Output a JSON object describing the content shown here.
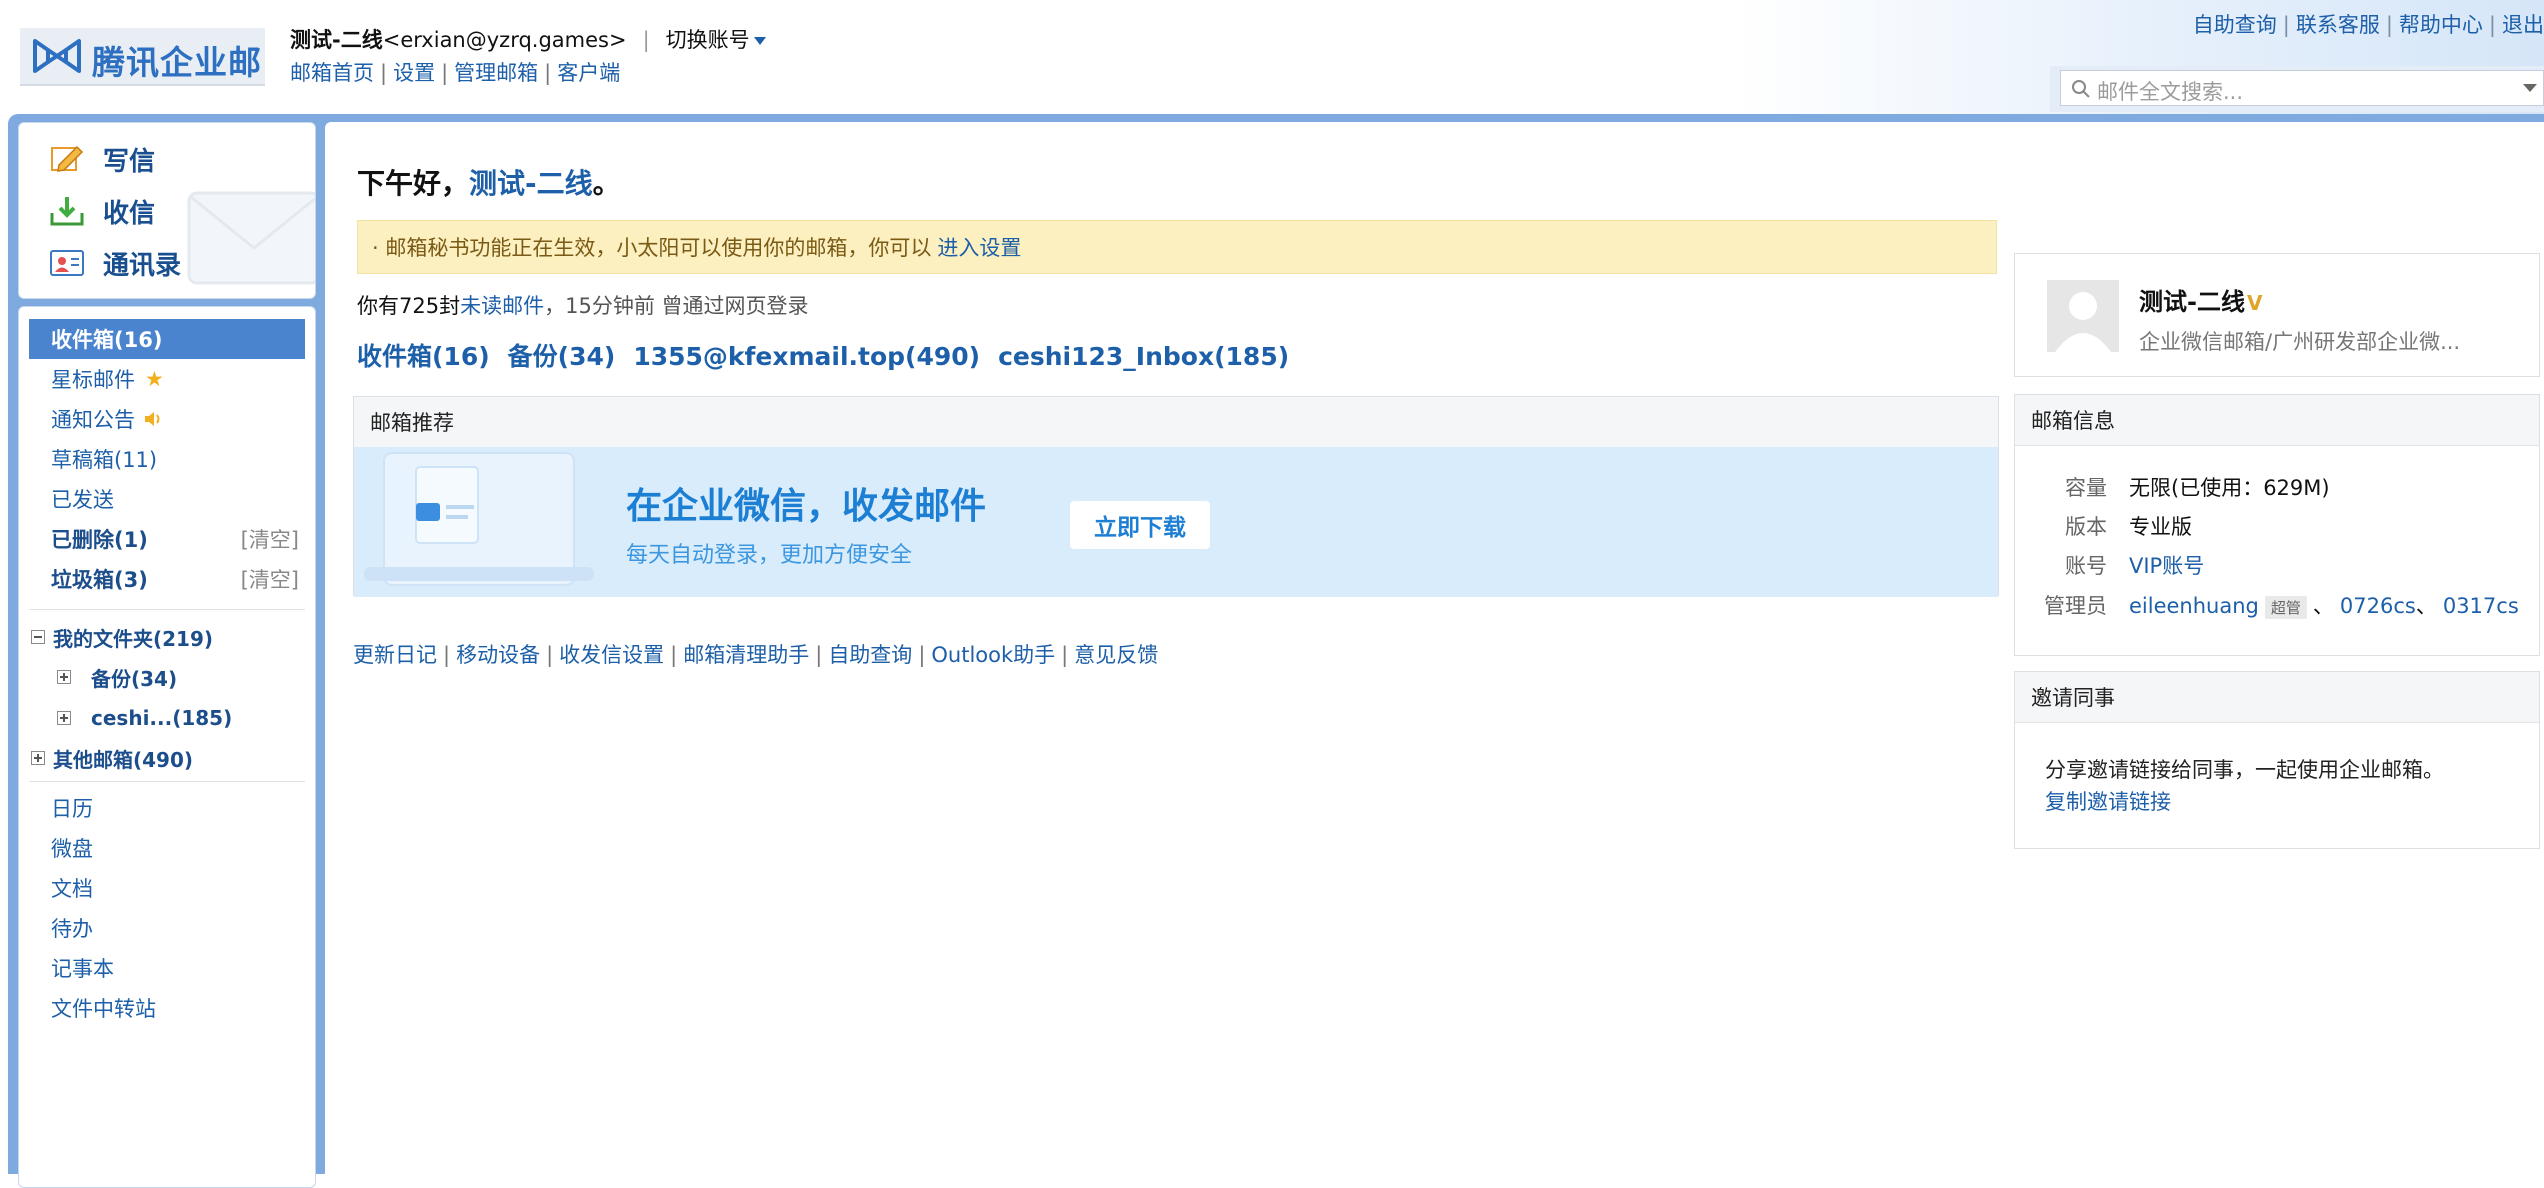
{
  "brand": {
    "logo_text": "腾讯企业邮"
  },
  "account": {
    "display_name": "测试-二线",
    "email": "<erxian@yzrq.games>",
    "switch_label": "切换账号"
  },
  "nav": {
    "links": [
      "邮箱首页",
      "设置",
      "管理邮箱",
      "客户端"
    ]
  },
  "top_right": {
    "links": [
      "自助查询",
      "联系客服",
      "帮助中心",
      "退出"
    ]
  },
  "search": {
    "placeholder": "邮件全文搜索..."
  },
  "actions": {
    "compose": "写信",
    "receive": "收信",
    "contacts": "通讯录"
  },
  "folders": {
    "inbox": "收件箱(16)",
    "starred": "星标邮件",
    "notice": "通知公告",
    "drafts": "草稿箱(11)",
    "sent": "已发送",
    "deleted": "已删除(1)",
    "spam": "垃圾箱(3)",
    "clear_label": "[清空]"
  },
  "my_folders": {
    "title": "我的文件夹(219)",
    "items": [
      "备份(34)",
      "ceshi...(185)"
    ]
  },
  "other_mailboxes": "其他邮箱(490)",
  "tools": [
    "日历",
    "微盘",
    "文档",
    "待办",
    "记事本",
    "文件中转站"
  ],
  "greeting": {
    "prefix": "下午好，",
    "name": "测试-二线",
    "suffix": "。"
  },
  "notice": {
    "text": "· 邮箱秘书功能正在生效，小太阳可以使用你的邮箱，你可以 ",
    "link": "进入设置"
  },
  "unread": {
    "prefix": "你有",
    "count": "725",
    "unit": "封",
    "link": "未读邮件",
    "rest": "，15分钟前 曾通过网页登录"
  },
  "quick_folders": [
    "收件箱(16)",
    "备份(34)",
    "1355@kfexmail.top(490)",
    "ceshi123_Inbox(185)"
  ],
  "recommend": {
    "title": "邮箱推荐",
    "headline": "在企业微信，收发邮件",
    "subline": "每天自动登录，更加方便安全",
    "button": "立即下载"
  },
  "footer_links": [
    "更新日记",
    "移动设备",
    "收发信设置",
    "邮箱清理助手",
    "自助查询",
    "Outlook助手",
    "意见反馈"
  ],
  "profile": {
    "name": "测试-二线",
    "vip_mark": "V",
    "org": "企业微信邮箱/广州研发部企业微..."
  },
  "mailbox_info": {
    "title": "邮箱信息",
    "rows": [
      {
        "k": "容量",
        "v": "无限(已使用：629M)"
      },
      {
        "k": "版本",
        "v": "专业版"
      },
      {
        "k": "账号",
        "v": "VIP账号"
      }
    ],
    "admin_label": "管理员",
    "admins": [
      "eileenhuang",
      "0726cs",
      "0317cs"
    ],
    "super_badge": "超管"
  },
  "invite": {
    "title": "邀请同事",
    "text": "分享邀请链接给同事，一起使用企业邮箱。",
    "link": "复制邀请链接"
  },
  "colors": {
    "brand_blue": "#2d6fc0",
    "frame_blue": "#7eaae0",
    "active": "#4a84cf",
    "link": "#1d5fa8",
    "notice_bg": "#fcefc0"
  }
}
